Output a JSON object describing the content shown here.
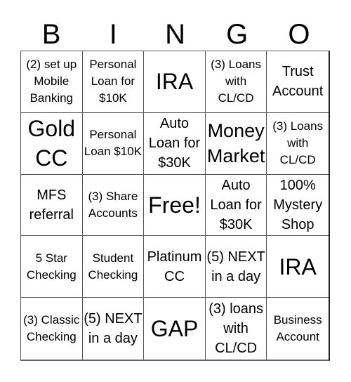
{
  "header": {
    "letters": [
      "B",
      "I",
      "N",
      "G",
      "O"
    ]
  },
  "cells": [
    {
      "text": "(2) set up Mobile Banking",
      "size": "sm"
    },
    {
      "text": "Personal Loan for $10K",
      "size": "sm"
    },
    {
      "text": "IRA",
      "size": "xl"
    },
    {
      "text": "(3) Loans with CL/CD",
      "size": "sm"
    },
    {
      "text": "Trust Account",
      "size": "md"
    },
    {
      "text": "Gold CC",
      "size": "xl"
    },
    {
      "text": "Personal Loan $10K",
      "size": "sm"
    },
    {
      "text": "Auto Loan for $30K",
      "size": "md"
    },
    {
      "text": "Money Market",
      "size": "lg"
    },
    {
      "text": "(3) Loans with CL/CD",
      "size": "sm"
    },
    {
      "text": "MFS referral",
      "size": "md"
    },
    {
      "text": "(3) Share Accounts",
      "size": "sm"
    },
    {
      "text": "Free!",
      "size": "xl"
    },
    {
      "text": "Auto Loan for $30K",
      "size": "md"
    },
    {
      "text": "100% Mystery Shop",
      "size": "md"
    },
    {
      "text": "5 Star Checking",
      "size": "sm"
    },
    {
      "text": "Student Checking",
      "size": "sm"
    },
    {
      "text": "Platinum CC",
      "size": "md"
    },
    {
      "text": "(5) NEXT in a day",
      "size": "md"
    },
    {
      "text": "IRA",
      "size": "xl"
    },
    {
      "text": "(3) Classic Checking",
      "size": "sm"
    },
    {
      "text": "(5) NEXT in a day",
      "size": "md"
    },
    {
      "text": "GAP",
      "size": "xl"
    },
    {
      "text": "(3) loans with CL/CD",
      "size": "md"
    },
    {
      "text": "Business Account",
      "size": "sm"
    }
  ]
}
